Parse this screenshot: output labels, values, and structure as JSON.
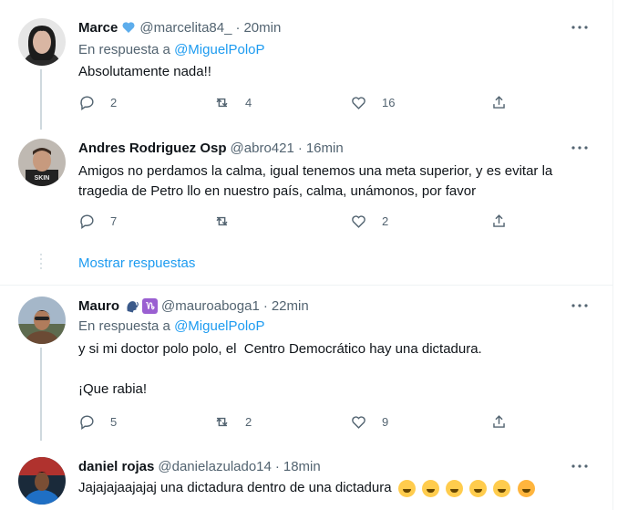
{
  "tweets": [
    {
      "name": "Marce",
      "handle": "@marcelita84_",
      "separator": "·",
      "time": "20min",
      "reply_prefix": "En respuesta a",
      "reply_to": "@MiguelPoloP",
      "text": "Absolutamente nada!!",
      "replies": "2",
      "retweets": "4",
      "likes": "16",
      "badge_icon": "blue-heart"
    },
    {
      "name": "Andres Rodriguez Osp",
      "handle": "@abro421",
      "separator": "·",
      "time": "16min",
      "text": "Amigos no perdamos la calma, igual tenemos una meta superior, y es evitar la tragedia de Petro llo en nuestro país, calma, unámonos, por favor",
      "replies": "7",
      "retweets": "",
      "likes": "2"
    },
    {
      "name": "Mauro",
      "handle": "@mauroaboga1",
      "separator": "·",
      "time": "22min",
      "reply_prefix": "En respuesta a",
      "reply_to": "@MiguelPoloP",
      "text": "y si mi doctor polo polo, el  Centro Democrático hay una dictadura.\n\n¡Que rabia!",
      "replies": "5",
      "retweets": "2",
      "likes": "9",
      "badge_icons": [
        "speaking-head",
        "capricorn-sign"
      ]
    },
    {
      "name": "daniel rojas",
      "handle": "@danielazulado14",
      "separator": "·",
      "time": "18min",
      "text": "Jajajajaajajaj una dictadura dentro de una dictadura",
      "emoji_icons": [
        "joy",
        "joy",
        "joy",
        "joy",
        "joy",
        "yawning"
      ]
    }
  ],
  "show_replies": "Mostrar respuestas",
  "colors": {
    "accent": "#1d9bf0",
    "secondary": "#536471",
    "border": "#eff3f4"
  }
}
